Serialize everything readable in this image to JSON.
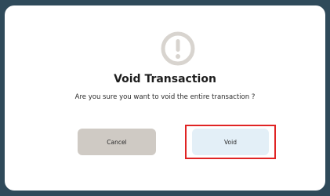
{
  "dialog": {
    "icon": "exclamation-circle-icon",
    "title": "Void Transaction",
    "message": "Are you sure you want to void the entire transaction ?",
    "cancel_label": "Cancel",
    "void_label": "Void"
  },
  "colors": {
    "backdrop": "#2f4a5a",
    "icon": "#d8d4cf",
    "cancel_button": "#cfcac4",
    "void_button": "#e3eff7",
    "highlight_border": "#e02424"
  }
}
